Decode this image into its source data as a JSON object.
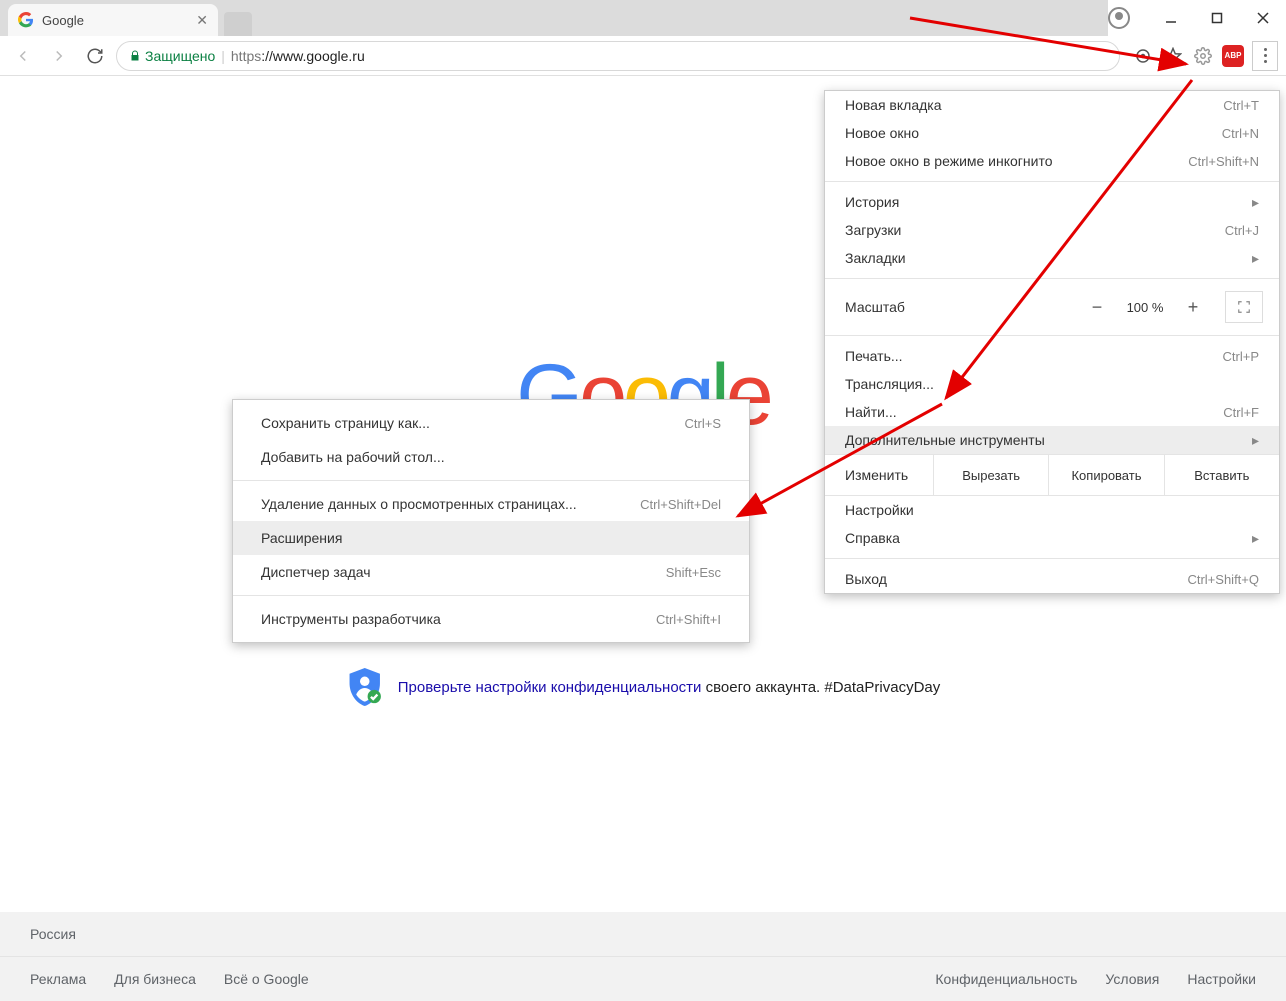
{
  "window": {
    "tab_title": "Google"
  },
  "toolbar": {
    "secure_label": "Защищено",
    "url_proto": "https",
    "url_rest": "://www.google.ru"
  },
  "page": {
    "logo": [
      "G",
      "o",
      "o",
      "g",
      "l",
      "e"
    ],
    "privacy_link": "Проверьте настройки конфиденциальности",
    "privacy_tail": " своего аккаунта. #DataPrivacyDay"
  },
  "footer": {
    "country": "Россия",
    "left": [
      "Реклама",
      "Для бизнеса",
      "Всё о Google"
    ],
    "right": [
      "Конфиденциальность",
      "Условия",
      "Настройки"
    ]
  },
  "menu": {
    "new_tab": {
      "label": "Новая вкладка",
      "sc": "Ctrl+T"
    },
    "new_window": {
      "label": "Новое окно",
      "sc": "Ctrl+N"
    },
    "incognito": {
      "label": "Новое окно в режиме инкогнито",
      "sc": "Ctrl+Shift+N"
    },
    "history": {
      "label": "История"
    },
    "downloads": {
      "label": "Загрузки",
      "sc": "Ctrl+J"
    },
    "bookmarks": {
      "label": "Закладки"
    },
    "zoom": {
      "label": "Масштаб",
      "value": "100 %"
    },
    "print": {
      "label": "Печать...",
      "sc": "Ctrl+P"
    },
    "cast": {
      "label": "Трансляция..."
    },
    "find": {
      "label": "Найти...",
      "sc": "Ctrl+F"
    },
    "more_tools": {
      "label": "Дополнительные инструменты"
    },
    "edit": {
      "label": "Изменить",
      "cut": "Вырезать",
      "copy": "Копировать",
      "paste": "Вставить"
    },
    "settings": {
      "label": "Настройки"
    },
    "help": {
      "label": "Справка"
    },
    "exit": {
      "label": "Выход",
      "sc": "Ctrl+Shift+Q"
    }
  },
  "submenu": {
    "save_as": {
      "label": "Сохранить страницу как...",
      "sc": "Ctrl+S"
    },
    "add_desktop": {
      "label": "Добавить на рабочий стол..."
    },
    "clear_data": {
      "label": "Удаление данных о просмотренных страницах...",
      "sc": "Ctrl+Shift+Del"
    },
    "extensions": {
      "label": "Расширения"
    },
    "task_manager": {
      "label": "Диспетчер задач",
      "sc": "Shift+Esc"
    },
    "dev_tools": {
      "label": "Инструменты разработчика",
      "sc": "Ctrl+Shift+I"
    }
  }
}
